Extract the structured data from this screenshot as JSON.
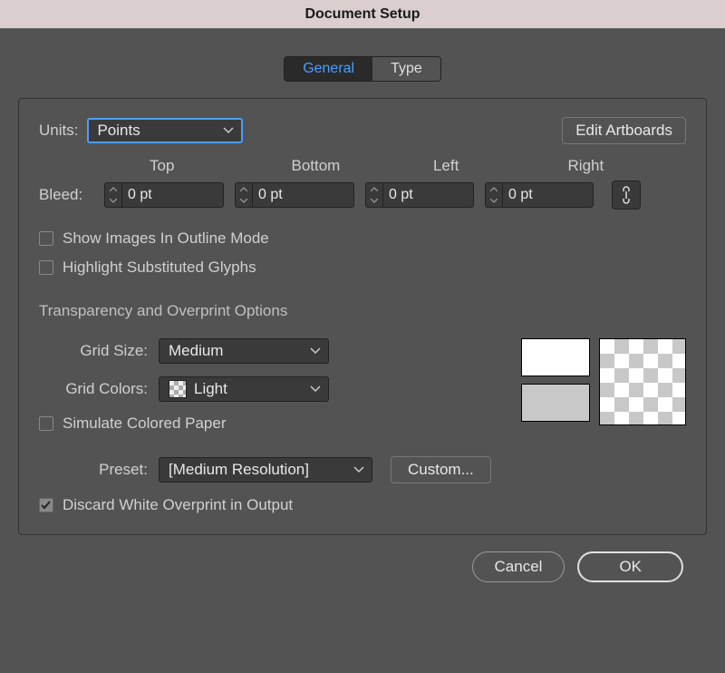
{
  "title": "Document Setup",
  "tabs": {
    "general": "General",
    "type": "Type",
    "active": "general"
  },
  "units": {
    "label": "Units:",
    "value": "Points"
  },
  "edit_artboards": "Edit Artboards",
  "bleed": {
    "label": "Bleed:",
    "headers": {
      "top": "Top",
      "bottom": "Bottom",
      "left": "Left",
      "right": "Right"
    },
    "values": {
      "top": "0 pt",
      "bottom": "0 pt",
      "left": "0 pt",
      "right": "0 pt"
    }
  },
  "show_images": "Show Images In Outline Mode",
  "highlight_glyphs": "Highlight Substituted Glyphs",
  "transparency_title": "Transparency and Overprint Options",
  "grid_size": {
    "label": "Grid Size:",
    "value": "Medium"
  },
  "grid_colors": {
    "label": "Grid Colors:",
    "value": "Light"
  },
  "simulate_paper": "Simulate Colored Paper",
  "preset": {
    "label": "Preset:",
    "value": "[Medium Resolution]"
  },
  "custom": "Custom...",
  "discard_white": "Discard White Overprint in Output",
  "buttons": {
    "cancel": "Cancel",
    "ok": "OK"
  }
}
